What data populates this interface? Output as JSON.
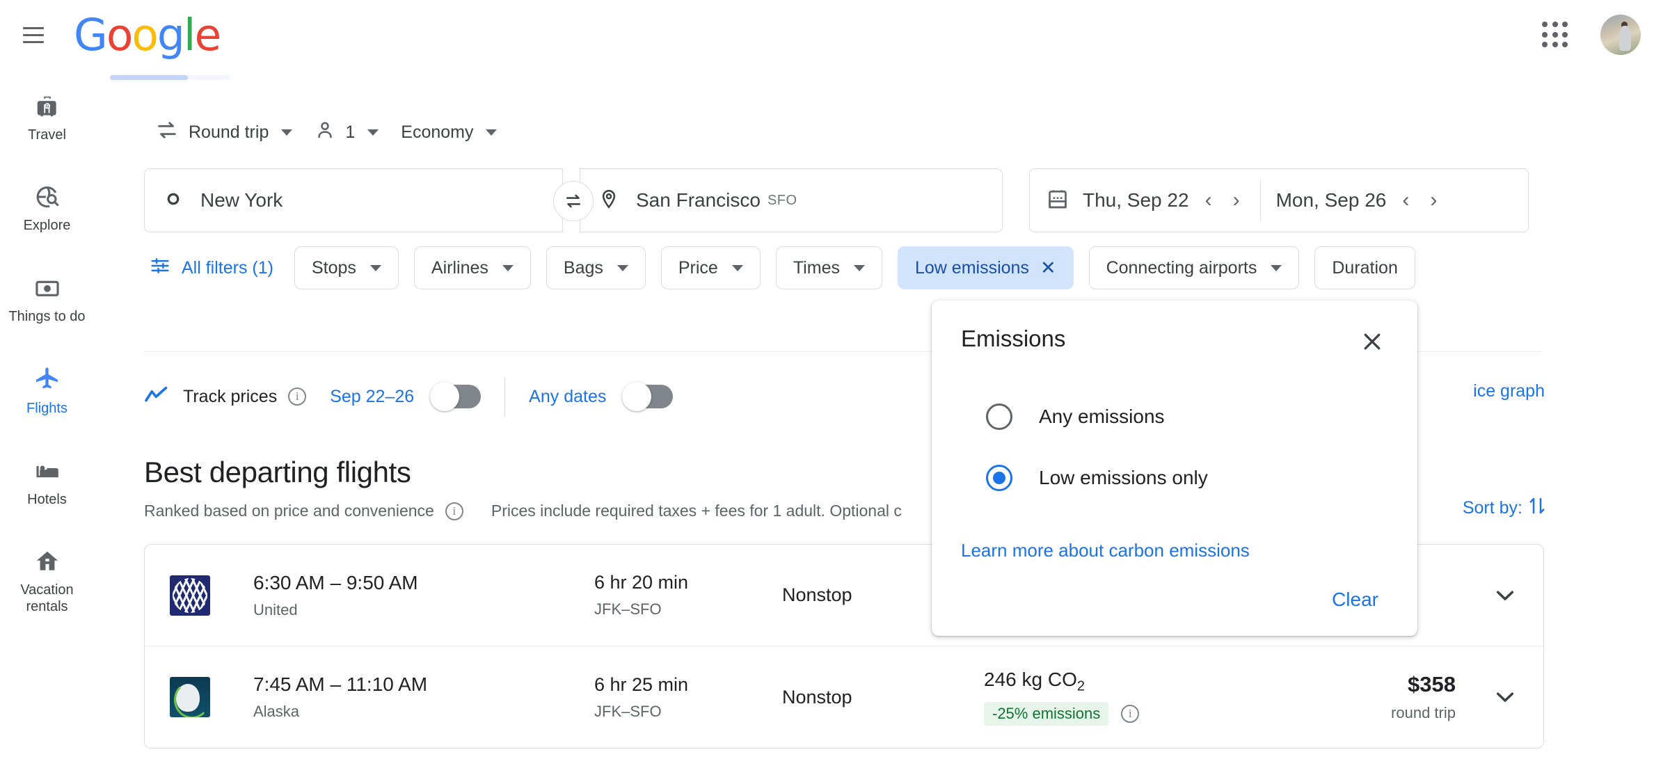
{
  "header": {
    "menu_label": "Main menu",
    "logo_text": "Google",
    "apps_label": "Google apps",
    "avatar_label": "Account"
  },
  "sidebar": {
    "items": [
      {
        "label": "Travel",
        "icon": "suitcase-icon",
        "active": false
      },
      {
        "label": "Explore",
        "icon": "explore-globe-icon",
        "active": false
      },
      {
        "label": "Things to do",
        "icon": "camera-icon",
        "active": false
      },
      {
        "label": "Flights",
        "icon": "airplane-icon",
        "active": true
      },
      {
        "label": "Hotels",
        "icon": "bed-icon",
        "active": false
      },
      {
        "label": "Vacation rentals",
        "icon": "house-icon",
        "active": false
      }
    ]
  },
  "search": {
    "trip_type": "Round trip",
    "passengers": "1",
    "cabin_class": "Economy",
    "origin": "New York",
    "origin_code": "",
    "destination": "San Francisco",
    "destination_code": "SFO",
    "depart_date": "Thu, Sep 22",
    "return_date": "Mon, Sep 26",
    "swap_label": "Swap origin and destination"
  },
  "filters": {
    "all_filters_label": "All filters (1)",
    "chips": [
      {
        "label": "Stops",
        "has_caret": true,
        "active": false
      },
      {
        "label": "Airlines",
        "has_caret": true,
        "active": false
      },
      {
        "label": "Bags",
        "has_caret": true,
        "active": false
      },
      {
        "label": "Price",
        "has_caret": true,
        "active": false
      },
      {
        "label": "Times",
        "has_caret": true,
        "active": false
      },
      {
        "label": "Low emissions",
        "has_caret": false,
        "active": true
      },
      {
        "label": "Connecting airports",
        "has_caret": true,
        "active": false
      },
      {
        "label": "Duration",
        "has_caret": false,
        "active": false
      }
    ]
  },
  "tracking": {
    "track_prices_label": "Track prices",
    "date_range_label": "Sep 22–26",
    "any_dates_label": "Any dates",
    "track_toggle_on": false,
    "any_dates_toggle_on": false,
    "price_graph_label": "ice graph",
    "sort_by_label": "Sort by:"
  },
  "results": {
    "title": "Best departing flights",
    "ranked_note": "Ranked based on price and convenience",
    "prices_note": "Prices include required taxes + fees for 1 adult. Optional c",
    "rows": [
      {
        "airline": "United",
        "logo": "united-logo",
        "times": "6:30 AM – 9:50 AM",
        "duration": "6 hr 20 min",
        "route": "JFK–SFO",
        "stops": "Nonstop",
        "emissions": "",
        "emissions_badge": "",
        "price": "",
        "price_sub": ""
      },
      {
        "airline": "Alaska",
        "logo": "alaska-logo",
        "times": "7:45 AM – 11:10 AM",
        "duration": "6 hr 25 min",
        "route": "JFK–SFO",
        "stops": "Nonstop",
        "emissions": "246 kg CO",
        "emissions_sub": "2",
        "emissions_badge": "-25% emissions",
        "price": "$358",
        "price_sub": "round trip"
      }
    ]
  },
  "emissions_popup": {
    "title": "Emissions",
    "close_label": "Close",
    "options": [
      {
        "label": "Any emissions",
        "selected": false
      },
      {
        "label": "Low emissions only",
        "selected": true
      }
    ],
    "learn_more_label": "Learn more about carbon emissions",
    "clear_label": "Clear"
  },
  "colors": {
    "accent_blue": "#1a73e8",
    "chip_active_bg": "#d2e3fc",
    "badge_green_bg": "#e6f4ea",
    "badge_green_text": "#137333"
  }
}
